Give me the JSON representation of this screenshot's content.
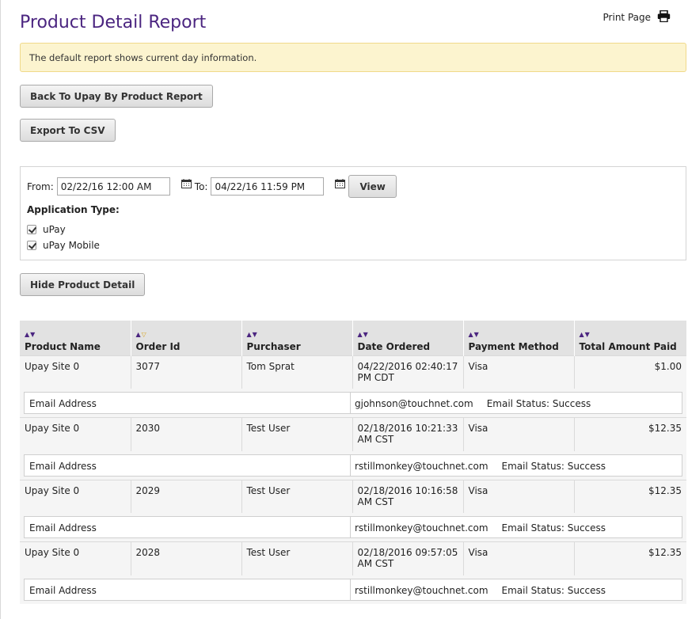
{
  "page": {
    "title": "Product Detail Report",
    "print_label": "Print Page",
    "notice": "The default report shows current day information."
  },
  "buttons": {
    "back": "Back To Upay By Product Report",
    "export": "Export To CSV",
    "hide_detail": "Hide Product Detail",
    "view": "View"
  },
  "filter": {
    "from_label": "From:",
    "from_value": "02/22/16 12:00 AM",
    "to_label": "To:",
    "to_value": "04/22/16 11:59 PM",
    "app_type_label": "Application Type:",
    "options": [
      {
        "label": "uPay",
        "checked": true
      },
      {
        "label": "uPay Mobile",
        "checked": true
      }
    ]
  },
  "table": {
    "columns": [
      "Product Name",
      "Order Id",
      "Purchaser",
      "Date Ordered",
      "Payment Method",
      "Total Amount Paid"
    ],
    "rows": [
      {
        "product": "Upay Site 0",
        "order_id": "3077",
        "purchaser": "Tom Sprat",
        "date": "04/22/2016 02:40:17 PM CDT",
        "method": "Visa",
        "amount": "$1.00",
        "email_label": "Email Address",
        "email": "gjohnson@touchnet.com",
        "email_status": "Email Status: Success"
      },
      {
        "product": "Upay Site 0",
        "order_id": "2030",
        "purchaser": "Test User",
        "date": "02/18/2016 10:21:33 AM CST",
        "method": "Visa",
        "amount": "$12.35",
        "email_label": "Email Address",
        "email": "rstillmonkey@touchnet.com",
        "email_status": "Email Status: Success"
      },
      {
        "product": "Upay Site 0",
        "order_id": "2029",
        "purchaser": "Test User",
        "date": "02/18/2016 10:16:58 AM CST",
        "method": "Visa",
        "amount": "$12.35",
        "email_label": "Email Address",
        "email": "rstillmonkey@touchnet.com",
        "email_status": "Email Status: Success"
      },
      {
        "product": "Upay Site 0",
        "order_id": "2028",
        "purchaser": "Test User",
        "date": "02/18/2016 09:57:05 AM CST",
        "method": "Visa",
        "amount": "$12.35",
        "email_label": "Email Address",
        "email": "rstillmonkey@touchnet.com",
        "email_status": "Email Status: Success"
      }
    ]
  },
  "colors": {
    "title": "#4b2580",
    "notice_bg": "#fcf4cf",
    "header_bg": "#e2e2e2",
    "sort_active": "#d9a520"
  },
  "icons": {
    "print": "printer-icon",
    "calendar": "calendar-icon",
    "sort": "sort-arrows-icon"
  }
}
